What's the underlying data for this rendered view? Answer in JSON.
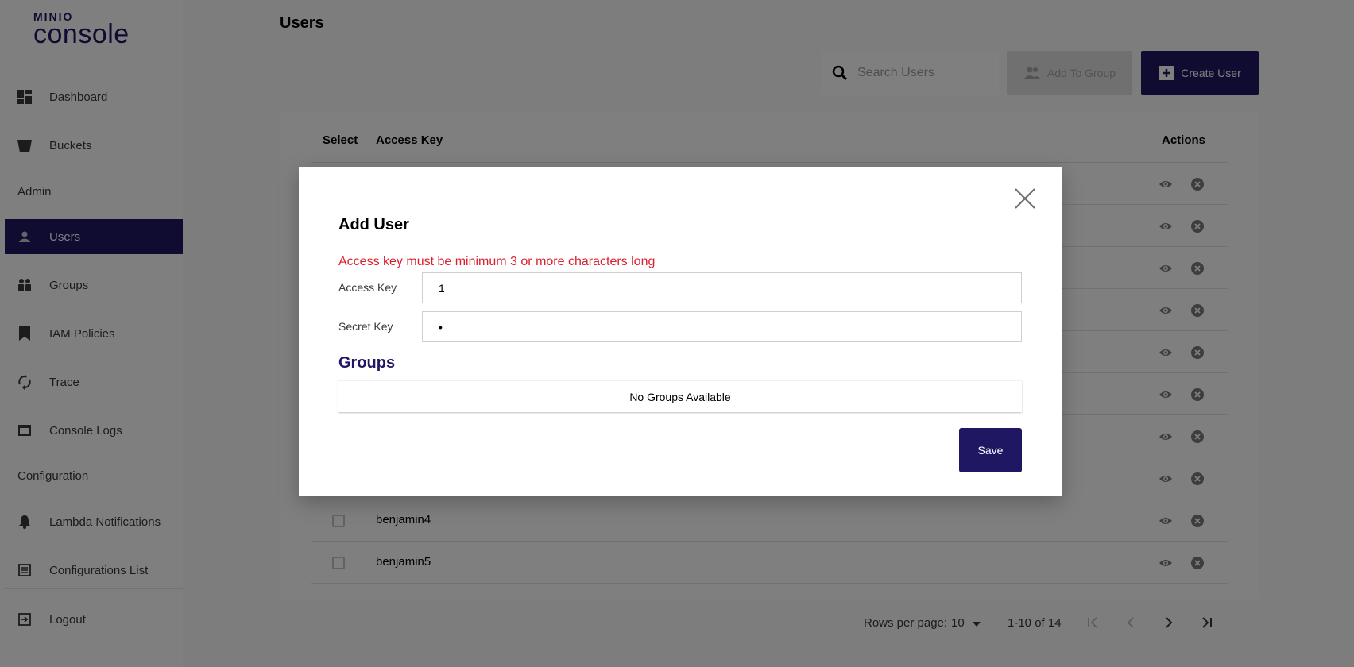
{
  "sidebar": {
    "logo_top": "MINIO",
    "logo_bottom": "console",
    "items": [
      {
        "label": "Dashboard",
        "icon": "dashboard-icon"
      },
      {
        "label": "Buckets",
        "icon": "bucket-icon"
      },
      {
        "label": "Users",
        "icon": "person-icon",
        "active": true
      },
      {
        "label": "Groups",
        "icon": "groups-icon"
      },
      {
        "label": "IAM Policies",
        "icon": "bookmark-icon"
      },
      {
        "label": "Trace",
        "icon": "sync-icon"
      },
      {
        "label": "Console Logs",
        "icon": "window-icon"
      },
      {
        "label": "Lambda Notifications",
        "icon": "bell-icon"
      },
      {
        "label": "Configurations List",
        "icon": "list-icon"
      },
      {
        "label": "Logout",
        "icon": "logout-icon"
      }
    ],
    "sections": {
      "admin": "Admin",
      "configuration": "Configuration"
    }
  },
  "header": {
    "title": "Users",
    "search_placeholder": "Search Users",
    "add_to_group_label": "Add To Group",
    "create_user_label": "Create User"
  },
  "table": {
    "columns": {
      "select": "Select",
      "access_key": "Access Key",
      "actions": "Actions"
    },
    "rows": [
      "",
      "",
      "",
      "",
      "",
      "",
      "",
      "",
      "benjamin4",
      "benjamin5"
    ]
  },
  "pagination": {
    "rows_per_page_label": "Rows per page:",
    "rows_per_page_value": "10",
    "range": "1-10 of 14"
  },
  "modal": {
    "title": "Add User",
    "error": "Access key must be minimum 3 or more characters long",
    "access_key_label": "Access Key",
    "access_key_value": "1",
    "secret_key_label": "Secret Key",
    "secret_key_value": "•",
    "groups_title": "Groups",
    "no_groups": "No Groups Available",
    "save_label": "Save"
  },
  "colors": {
    "brand": "#201763",
    "error": "#dc1f2e",
    "overlay": "rgba(0,0,0,0.5)"
  }
}
